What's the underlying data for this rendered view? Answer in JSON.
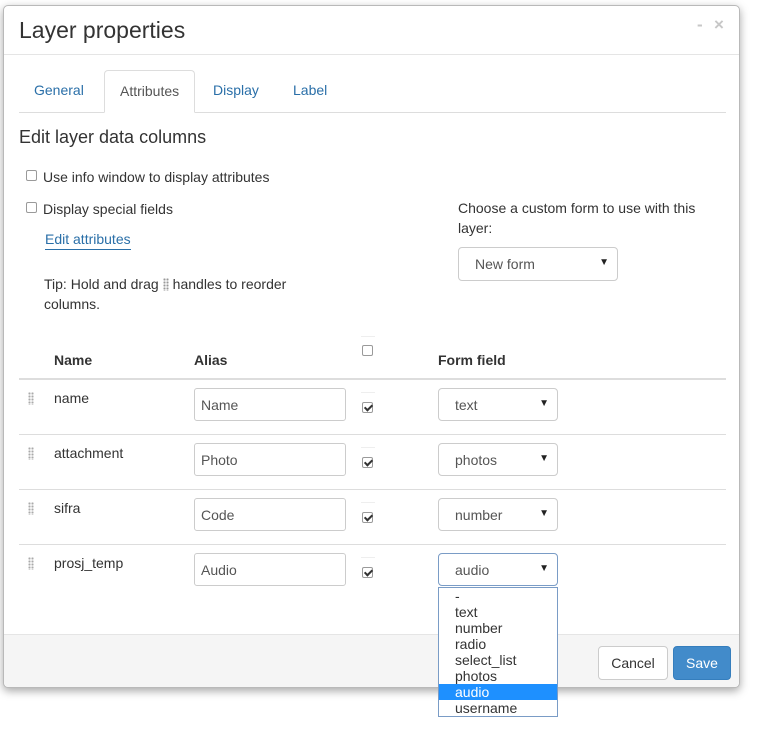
{
  "dialog": {
    "title": "Layer properties",
    "minimize_icon": "minimize-icon",
    "close_icon": "close-icon",
    "minimize_glyph": "-",
    "close_glyph": "×"
  },
  "tabs": [
    {
      "label": "General",
      "active": false
    },
    {
      "label": "Attributes",
      "active": true
    },
    {
      "label": "Display",
      "active": false
    },
    {
      "label": "Label",
      "active": false
    }
  ],
  "section": {
    "title": "Edit layer data columns"
  },
  "options": {
    "info_window": {
      "label": "Use info window to display attributes",
      "checked": false
    },
    "special_fields": {
      "label": "Display special fields",
      "checked": false
    },
    "edit_attributes_link": "Edit attributes",
    "tip_before": "Tip: Hold and drag",
    "tip_after": "handles to reorder columns."
  },
  "custom_form": {
    "label": "Choose a custom form to use with this layer:",
    "selected": "New form"
  },
  "table": {
    "headers": {
      "name": "Name",
      "alias": "Alias",
      "form_field": "Form field"
    },
    "rows": [
      {
        "name": "name",
        "alias": "Name",
        "visible": true,
        "form_field": "text"
      },
      {
        "name": "attachment",
        "alias": "Photo",
        "visible": true,
        "form_field": "photos"
      },
      {
        "name": "sifra",
        "alias": "Code",
        "visible": true,
        "form_field": "number"
      },
      {
        "name": "prosj_temp",
        "alias": "Audio",
        "visible": true,
        "form_field": "audio"
      }
    ]
  },
  "form_field_options": [
    "-",
    "text",
    "number",
    "radio",
    "select_list",
    "photos",
    "audio",
    "username"
  ],
  "form_field_open_selected": "audio",
  "footer": {
    "cancel_label": "Cancel",
    "save_label": "Save"
  },
  "colors": {
    "primary": "#428bca",
    "link": "#2a6fa8",
    "dropdown_highlight": "#1e90ff"
  }
}
